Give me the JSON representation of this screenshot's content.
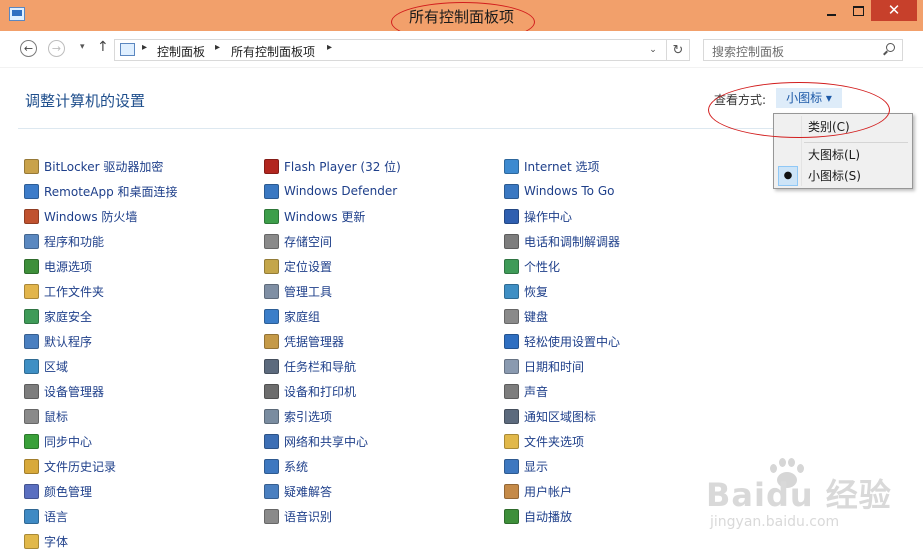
{
  "window": {
    "title": "所有控制面板项",
    "controls": {
      "minimize": "minimize",
      "maximize": "maximize",
      "close": "✕"
    }
  },
  "navbar": {
    "back_glyph": "←",
    "forward_glyph": "→",
    "recent_glyph": "▾",
    "up_glyph": "↑",
    "breadcrumb": [
      "控制面板",
      "所有控制面板项"
    ],
    "separator": "▸",
    "dropdown_glyph": "⌄",
    "refresh_glyph": "↻",
    "search_placeholder": "搜索控制面板"
  },
  "header": {
    "heading": "调整计算机的设置",
    "view_by_label": "查看方式:",
    "view_by_value": "小图标 ▾"
  },
  "view_menu": {
    "items": [
      {
        "label": "类别(C)",
        "checked": false
      },
      {
        "label": "大图标(L)",
        "checked": false
      },
      {
        "label": "小图标(S)",
        "checked": true
      }
    ],
    "check_glyph": "●"
  },
  "columns": [
    [
      {
        "label": "BitLocker 驱动器加密",
        "icon": "bitlocker-icon",
        "color": "#c9a24a"
      },
      {
        "label": "RemoteApp 和桌面连接",
        "icon": "remoteapp-icon",
        "color": "#3d7cc9"
      },
      {
        "label": "Windows 防火墙",
        "icon": "firewall-icon",
        "color": "#c0522f"
      },
      {
        "label": "程序和功能",
        "icon": "programs-icon",
        "color": "#5a88c0"
      },
      {
        "label": "电源选项",
        "icon": "power-icon",
        "color": "#3e8f3a"
      },
      {
        "label": "工作文件夹",
        "icon": "work-folders-icon",
        "color": "#e2b54c"
      },
      {
        "label": "家庭安全",
        "icon": "family-safety-icon",
        "color": "#3f9b58"
      },
      {
        "label": "默认程序",
        "icon": "default-programs-icon",
        "color": "#4a7fc0"
      },
      {
        "label": "区域",
        "icon": "region-icon",
        "color": "#3f8fc4"
      },
      {
        "label": "设备管理器",
        "icon": "device-manager-icon",
        "color": "#7d7d7d"
      },
      {
        "label": "鼠标",
        "icon": "mouse-icon",
        "color": "#8a8a8a"
      },
      {
        "label": "同步中心",
        "icon": "sync-center-icon",
        "color": "#3aa03a"
      },
      {
        "label": "文件历史记录",
        "icon": "file-history-icon",
        "color": "#d8a93a"
      },
      {
        "label": "颜色管理",
        "icon": "color-management-icon",
        "color": "#5a6fc0"
      },
      {
        "label": "语言",
        "icon": "language-icon",
        "color": "#3f8ac4"
      },
      {
        "label": "字体",
        "icon": "fonts-icon",
        "color": "#e1b84a"
      }
    ],
    [
      {
        "label": "Flash Player (32 位)",
        "icon": "flash-icon",
        "color": "#b2261f"
      },
      {
        "label": "Windows Defender",
        "icon": "defender-icon",
        "color": "#3a78c2"
      },
      {
        "label": "Windows 更新",
        "icon": "windows-update-icon",
        "color": "#3d9e4a"
      },
      {
        "label": "存储空间",
        "icon": "storage-spaces-icon",
        "color": "#8a8a8a"
      },
      {
        "label": "定位设置",
        "icon": "location-icon",
        "color": "#c4a64a"
      },
      {
        "label": "管理工具",
        "icon": "admin-tools-icon",
        "color": "#7f8fa4"
      },
      {
        "label": "家庭组",
        "icon": "homegroup-icon",
        "color": "#3b7ec9"
      },
      {
        "label": "凭据管理器",
        "icon": "credential-icon",
        "color": "#c59a48"
      },
      {
        "label": "任务栏和导航",
        "icon": "taskbar-icon",
        "color": "#5c6a7d"
      },
      {
        "label": "设备和打印机",
        "icon": "printers-icon",
        "color": "#6d6d6d"
      },
      {
        "label": "索引选项",
        "icon": "indexing-icon",
        "color": "#7a8ca0"
      },
      {
        "label": "网络和共享中心",
        "icon": "network-icon",
        "color": "#3d6fb5"
      },
      {
        "label": "系统",
        "icon": "system-icon",
        "color": "#3e78c0"
      },
      {
        "label": "疑难解答",
        "icon": "troubleshoot-icon",
        "color": "#4a7fc0"
      },
      {
        "label": "语音识别",
        "icon": "speech-icon",
        "color": "#8a8a8a"
      }
    ],
    [
      {
        "label": "Internet 选项",
        "icon": "internet-options-icon",
        "color": "#3d8ad0"
      },
      {
        "label": "Windows To Go",
        "icon": "windows-to-go-icon",
        "color": "#3a78c2"
      },
      {
        "label": "操作中心",
        "icon": "action-center-icon",
        "color": "#2f5fb0"
      },
      {
        "label": "电话和调制解调器",
        "icon": "phone-modem-icon",
        "color": "#7d7d7d"
      },
      {
        "label": "个性化",
        "icon": "personalization-icon",
        "color": "#3f9b58"
      },
      {
        "label": "恢复",
        "icon": "recovery-icon",
        "color": "#3f8fc4"
      },
      {
        "label": "键盘",
        "icon": "keyboard-icon",
        "color": "#8a8a8a"
      },
      {
        "label": "轻松使用设置中心",
        "icon": "ease-of-access-icon",
        "color": "#2f6fc1"
      },
      {
        "label": "日期和时间",
        "icon": "date-time-icon",
        "color": "#8a9ab0"
      },
      {
        "label": "声音",
        "icon": "sound-icon",
        "color": "#7d7d7d"
      },
      {
        "label": "通知区域图标",
        "icon": "notification-icons-icon",
        "color": "#5c6a7d"
      },
      {
        "label": "文件夹选项",
        "icon": "folder-options-icon",
        "color": "#e1b84a"
      },
      {
        "label": "显示",
        "icon": "display-icon",
        "color": "#3e78c0"
      },
      {
        "label": "用户帐户",
        "icon": "user-accounts-icon",
        "color": "#c58a48"
      },
      {
        "label": "自动播放",
        "icon": "autoplay-icon",
        "color": "#3e8f3a"
      }
    ]
  ],
  "watermark": {
    "brand": "Baidu 经验",
    "sub": "jingyan.baidu.com"
  },
  "colors": {
    "titlebar": "#f2a06b",
    "link": "#1e3f8a",
    "heading": "#1e4e8c",
    "annotation": "#d21e1e"
  }
}
